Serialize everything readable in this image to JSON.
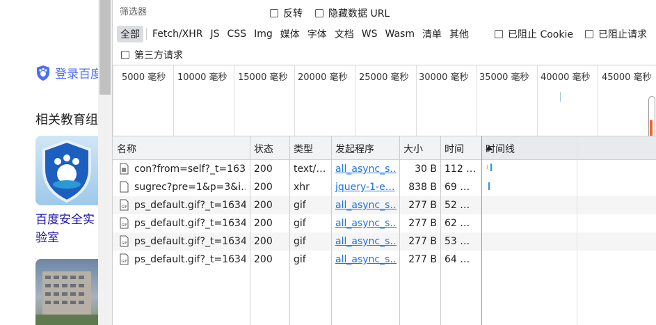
{
  "page": {
    "login_text": "登录百度",
    "edu_title": "相关教育组织",
    "card_title": "百度安全实验室"
  },
  "filter": {
    "placeholder": "筛选器"
  },
  "options": {
    "invert": "反转",
    "hide_data_url": "隐藏数据 URL",
    "blocked_cookies": "已阻止 Cookie",
    "blocked_requests": "已阻止请求",
    "third_party": "第三方请求"
  },
  "types": [
    "全部",
    "Fetch/XHR",
    "JS",
    "CSS",
    "Img",
    "媒体",
    "字体",
    "文档",
    "WS",
    "Wasm",
    "清单",
    "其他"
  ],
  "timeline_ticks": [
    "5000 毫秒",
    "10000 毫秒",
    "15000 毫秒",
    "20000 毫秒",
    "25000 毫秒",
    "30000 毫秒",
    "35000 毫秒",
    "40000 毫秒",
    "45000 毫秒"
  ],
  "columns": [
    "名称",
    "状态",
    "类型",
    "发起程序",
    "大小",
    "时间",
    "时间线"
  ],
  "rows": [
    {
      "name": "con?from=self?_t=163…",
      "status": "200",
      "type": "text/…",
      "initiator": "all_async_s…",
      "size": "30 B",
      "time": "112 …"
    },
    {
      "name": "sugrec?pre=1&p=3&i…",
      "status": "200",
      "type": "xhr",
      "initiator": "jquery-1-e…",
      "size": "838 B",
      "time": "69 …"
    },
    {
      "name": "ps_default.gif?_t=1634…",
      "status": "200",
      "type": "gif",
      "initiator": "all_async_s…",
      "size": "277 B",
      "time": "52 …"
    },
    {
      "name": "ps_default.gif?_t=1634…",
      "status": "200",
      "type": "gif",
      "initiator": "all_async_s…",
      "size": "277 B",
      "time": "62 …"
    },
    {
      "name": "ps_default.gif?_t=1634…",
      "status": "200",
      "type": "gif",
      "initiator": "all_async_s…",
      "size": "277 B",
      "time": "53 …"
    },
    {
      "name": "ps_default.gif?_t=1634…",
      "status": "200",
      "type": "gif",
      "initiator": "all_async_s…",
      "size": "277 B",
      "time": "64 …"
    }
  ],
  "colors": {
    "link": "#1a73e8",
    "waterfall": "#1a9ae8",
    "accent_scroll": "#f0642d"
  }
}
